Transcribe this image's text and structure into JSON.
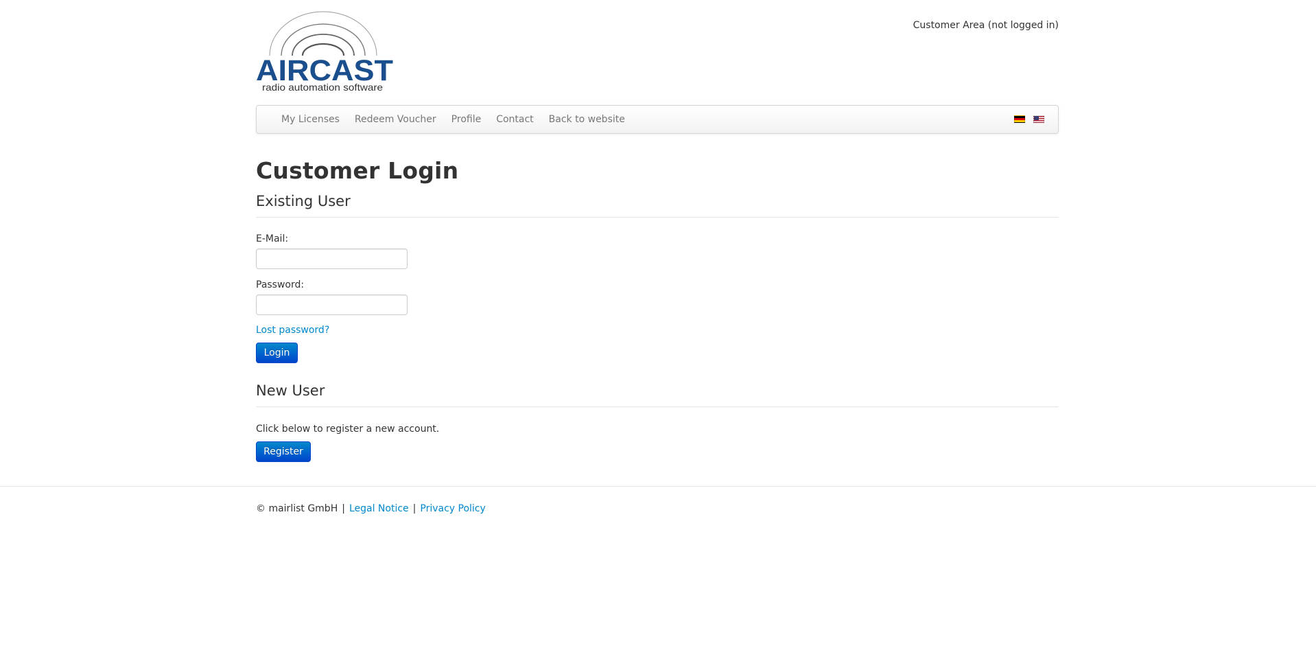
{
  "header": {
    "logo": {
      "brand": "AIRCAST",
      "tagline": "radio automation software"
    },
    "customer_status": "Customer Area (not logged in)"
  },
  "nav": {
    "items": [
      {
        "label": "My Licenses"
      },
      {
        "label": "Redeem Voucher"
      },
      {
        "label": "Profile"
      },
      {
        "label": "Contact"
      },
      {
        "label": "Back to website"
      }
    ],
    "flags": [
      {
        "icon": "flag-germany-icon"
      },
      {
        "icon": "flag-usa-icon"
      }
    ]
  },
  "main": {
    "title": "Customer Login",
    "existing_user": {
      "heading": "Existing User",
      "email_label": "E-Mail:",
      "email_value": "",
      "password_label": "Password:",
      "password_value": "",
      "lost_password": "Lost password?",
      "login_button": "Login"
    },
    "new_user": {
      "heading": "New User",
      "text": "Click below to register a new account.",
      "register_button": "Register"
    }
  },
  "footer": {
    "copyright": "© mairlist GmbH",
    "separator": "|",
    "legal_notice": "Legal Notice",
    "privacy_policy": "Privacy Policy"
  },
  "colors": {
    "brand": "#1a4e8c",
    "link": "#0088cc",
    "button_top": "#0088cc",
    "button_bottom": "#0044cc"
  }
}
